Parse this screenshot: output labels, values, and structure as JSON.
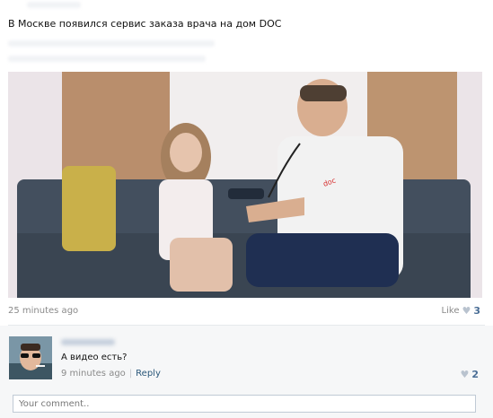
{
  "post": {
    "title": "В Москве появился сервис заказа врача на дом DOC",
    "time": "25 minutes ago",
    "like_label": "Like",
    "like_count": "3"
  },
  "comment": {
    "text": "А видео есть?",
    "time": "9 minutes ago",
    "separator": "|",
    "reply_label": "Reply",
    "like_count": "2"
  },
  "comment_input": {
    "placeholder": "Your comment.."
  },
  "colors": {
    "link": "#2b587a",
    "like_count": "#4a6e96",
    "heart": "#b9c3cf",
    "meta": "#8a8a8a"
  },
  "icons": {
    "like": "heart-icon"
  }
}
